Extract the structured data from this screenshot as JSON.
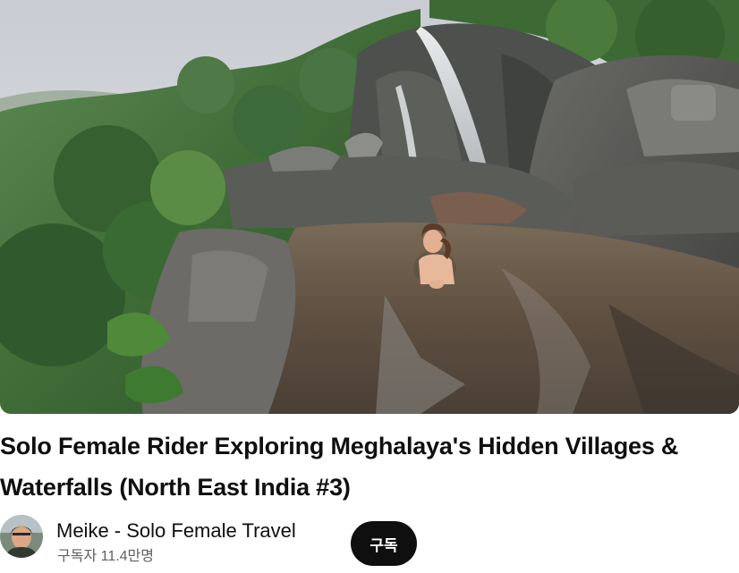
{
  "video": {
    "thumbnail_icon": "waterfall-pool-thumbnail",
    "title": "Solo Female Rider Exploring Meghalaya's Hidden Villages & Waterfalls (North East India #3)"
  },
  "channel": {
    "avatar_icon": "channel-avatar",
    "name": "Meike - Solo Female Travel",
    "subscribers": "구독자 11.4만명",
    "subscribe_label": "구독"
  },
  "colors": {
    "subscribe_bg": "#0f0f0f",
    "subscribe_text": "#ffffff",
    "meta_text": "#606060"
  }
}
